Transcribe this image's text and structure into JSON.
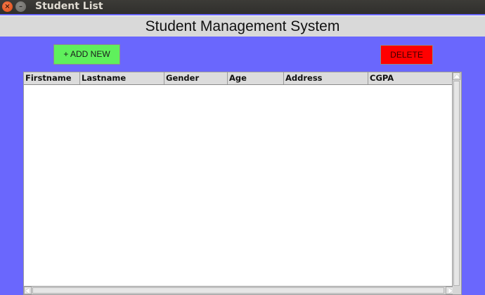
{
  "window": {
    "title": "Student List",
    "close_icon": "close-icon",
    "minimize_icon": "minimize-icon"
  },
  "header": {
    "title": "Student Management System"
  },
  "toolbar": {
    "add_label": "+ ADD NEW",
    "delete_label": "DELETE"
  },
  "table": {
    "columns": [
      "Firstname",
      "Lastname",
      "Gender",
      "Age",
      "Address",
      "CGPA"
    ],
    "rows": []
  },
  "colors": {
    "background": "#6a67fd",
    "add_button": "#5ff05c",
    "delete_button": "#ff0000",
    "header_band": "#d9d9d9"
  }
}
